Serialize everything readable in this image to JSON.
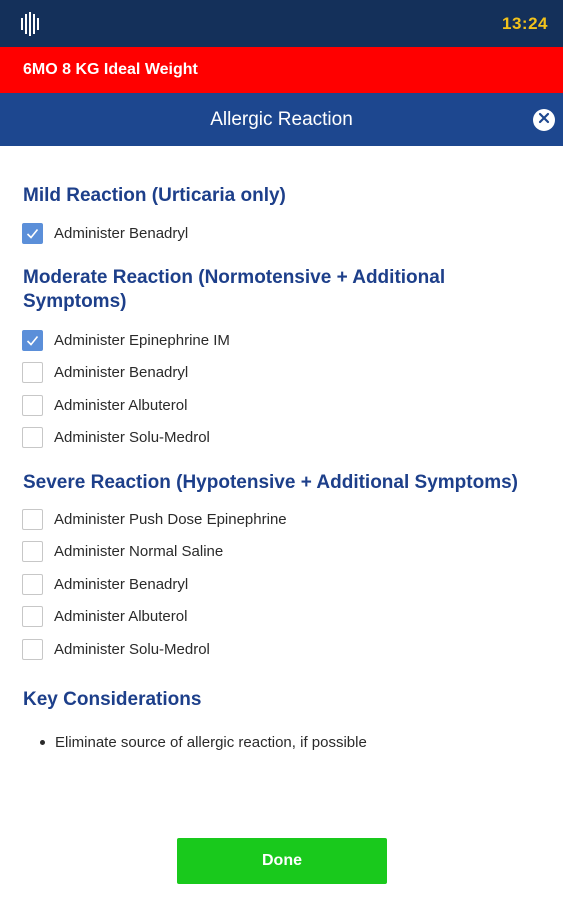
{
  "status_bar": {
    "time": "13:24",
    "logo_icon": "app-logo-icon"
  },
  "banner": {
    "text": "6MO 8 KG Ideal Weight",
    "color": "#ff0000"
  },
  "header": {
    "title": "Allergic Reaction",
    "close_icon": "close-icon"
  },
  "sections": {
    "mild": {
      "heading": "Mild Reaction (Urticaria only)",
      "items": [
        {
          "label": "Administer Benadryl",
          "checked": true
        }
      ]
    },
    "moderate": {
      "heading": "Moderate Reaction (Normotensive + Additional Symptoms)",
      "items": [
        {
          "label": "Administer Epinephrine IM",
          "checked": true
        },
        {
          "label": "Administer Benadryl",
          "checked": false
        },
        {
          "label": "Administer Albuterol",
          "checked": false
        },
        {
          "label": "Administer Solu-Medrol",
          "checked": false
        }
      ]
    },
    "severe": {
      "heading": "Severe Reaction (Hypotensive + Additional Symptoms)",
      "items": [
        {
          "label": "Administer Push Dose Epinephrine",
          "checked": false
        },
        {
          "label": "Administer Normal Saline",
          "checked": false
        },
        {
          "label": "Administer Benadryl",
          "checked": false
        },
        {
          "label": "Administer Albuterol",
          "checked": false
        },
        {
          "label": "Administer Solu-Medrol",
          "checked": false
        }
      ]
    },
    "key": {
      "heading": "Key Considerations",
      "bullets": [
        "Eliminate source of allergic reaction, if possible"
      ]
    }
  },
  "footer": {
    "done_label": "Done"
  },
  "colors": {
    "status_bar": "#14305a",
    "title_bar": "#1d478f",
    "heading": "#1d3f8a",
    "checkbox_checked": "#5b8fd9",
    "done_button": "#19c91c",
    "time": "#f2c21b"
  }
}
